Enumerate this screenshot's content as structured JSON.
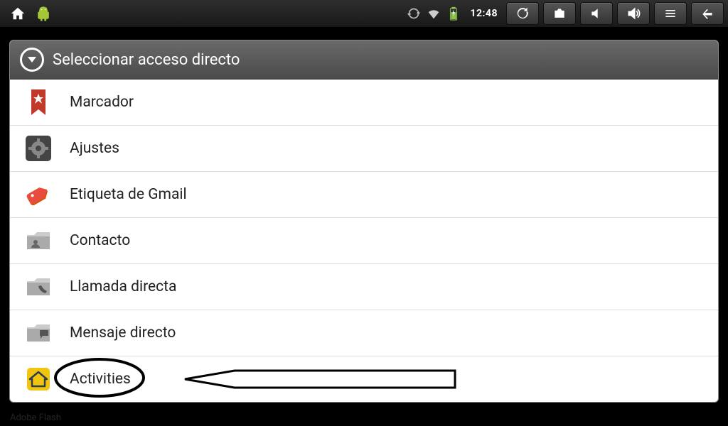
{
  "statusbar": {
    "clock": "12:48"
  },
  "dialog": {
    "title": "Seleccionar acceso directo",
    "items": [
      {
        "label": "Marcador",
        "icon": "bookmark"
      },
      {
        "label": "Ajustes",
        "icon": "settings"
      },
      {
        "label": "Etiqueta de Gmail",
        "icon": "gmail-tag"
      },
      {
        "label": "Contacto",
        "icon": "contact-folder"
      },
      {
        "label": "Llamada directa",
        "icon": "phone-folder"
      },
      {
        "label": "Mensaje directo",
        "icon": "message-folder"
      },
      {
        "label": "Activities",
        "icon": "activities-home",
        "highlighted": true
      }
    ]
  },
  "background_label": "Adobe Flash"
}
